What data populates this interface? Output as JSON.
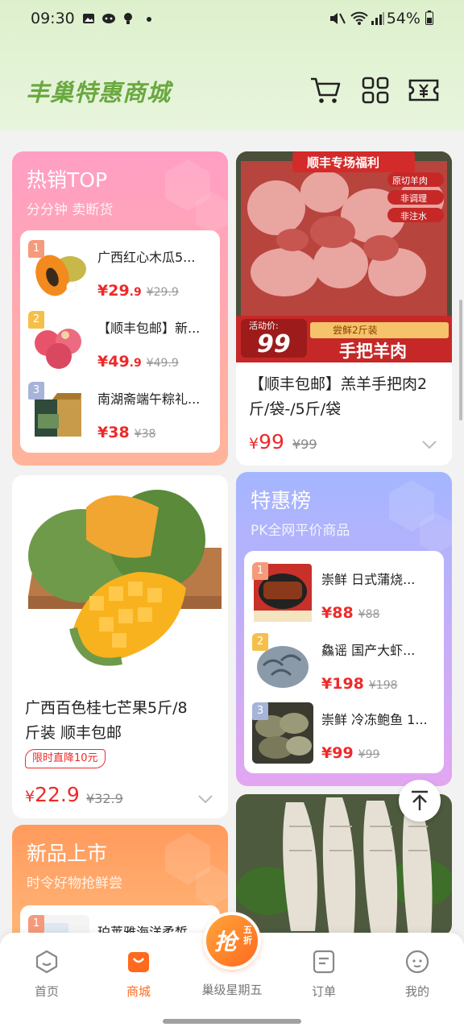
{
  "status_bar": {
    "time": "09:30",
    "battery": "54%"
  },
  "header": {
    "title": "丰巢特惠商城"
  },
  "hot_top": {
    "title": "热销TOP",
    "subtitle": "分分钟 卖断货",
    "items": [
      {
        "rank": "1",
        "name": "广西红心木瓜5...",
        "price_int": "¥29",
        "price_dec": ".9",
        "old_price": "¥29.9"
      },
      {
        "rank": "2",
        "name": "【顺丰包邮】新...",
        "price_int": "¥49",
        "price_dec": ".9",
        "old_price": "¥49.9"
      },
      {
        "rank": "3",
        "name": "南湖斋端午粽礼...",
        "price_int": "¥38",
        "price_dec": "",
        "old_price": "¥38"
      }
    ]
  },
  "lamb": {
    "banner_top": "顺丰专场福利",
    "tags": [
      "原切羊肉",
      "非调理",
      "非注水"
    ],
    "activity_label": "活动价:",
    "activity_price": "99",
    "taste_label": "尝鲜2斤装",
    "banner_title": "手把羊肉",
    "name_line1": "【顺丰包邮】羔羊手把肉2",
    "name_line2": "斤/袋-/5斤/袋",
    "price_yen": "¥",
    "price": "99",
    "old_price": "¥99"
  },
  "mango": {
    "name_line1": "广西百色桂七芒果5斤/8",
    "name_line2": "斤装 顺丰包邮",
    "tag": "限时直降10元",
    "price_yen": "¥",
    "price": "22.9",
    "old_price": "¥32.9"
  },
  "special": {
    "title": "特惠榜",
    "subtitle": "PK全网平价商品",
    "items": [
      {
        "rank": "1",
        "name": "崇鲜 日式蒲烧...",
        "price": "¥88",
        "old_price": "¥88"
      },
      {
        "rank": "2",
        "name": "鱻谣 国产大虾...",
        "price": "¥198",
        "old_price": "¥198"
      },
      {
        "rank": "3",
        "name": "崇鲜 冷冻鲍鱼 1...",
        "price": "¥99",
        "old_price": "¥99"
      }
    ]
  },
  "new_arrivals": {
    "title": "新品上市",
    "subtitle": "时令好物抢鲜尝",
    "first_item": {
      "rank": "1",
      "name": "珀莱雅海洋柔皙"
    }
  },
  "promo": {
    "main": "抢",
    "discount": "五折",
    "label": "巢级星期五"
  },
  "tabs": [
    {
      "label": "首页"
    },
    {
      "label": "商城"
    },
    {
      "label": "订单"
    },
    {
      "label": "我的"
    }
  ],
  "colors": {
    "accent": "#ff6a1f",
    "price_red": "#ee2a2a",
    "title_green": "#6aa840"
  }
}
